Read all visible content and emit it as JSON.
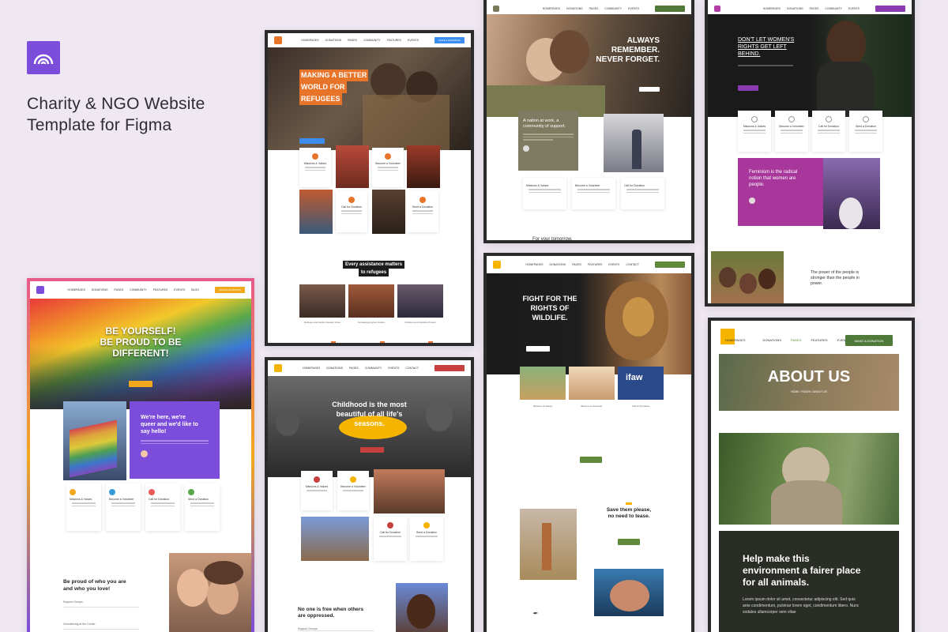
{
  "product": {
    "title_line1": "Charity & NGO Website",
    "title_line2": "Template for Figma",
    "brand_color": "#7c4ddb"
  },
  "nav_common": {
    "links": [
      "HOMEPAGES",
      "DONATIONS",
      "PAGES",
      "COMMUNITY",
      "FEATURES",
      "EVENTS",
      "BLOG",
      "CONTACT"
    ]
  },
  "refugees": {
    "hero_line1": "MAKING A BETTER",
    "hero_line2": "WORLD FOR",
    "hero_line3": "REFUGEES",
    "cta": "MAKE A DONATION",
    "accent": "#e8742a",
    "cards": [
      "Missions & Values",
      "Become a Volunteer",
      "Call for Donation",
      "Send a Donation"
    ],
    "band_line1": "Every assistance matters",
    "band_line2": "to refugees",
    "stories": [
      "Refugee and Asylum Seeker Voice",
      "Increasing Asylum Justice",
      "Children and Families Project"
    ]
  },
  "veterans": {
    "hero_line1": "ALWAYS",
    "hero_line2": "REMEMBER.",
    "hero_line3": "NEVER FORGET.",
    "quote_line1": "A nation at work, a",
    "quote_line2": "community of support.",
    "cards": [
      "Missions & Values",
      "Become a Volunteer",
      "Call for Donation"
    ],
    "footer_text": "For your tomorrow,",
    "accent": "#4f7a3a"
  },
  "women": {
    "hero_line1": "DON'T LET WOMEN'S",
    "hero_line2": "RIGHTS GET LEFT",
    "hero_line3": "BEHIND.",
    "accent": "#8a3bb2",
    "cards": [
      "Missions & Values",
      "Become a Volunteer",
      "Call for Donation",
      "Send a Donation"
    ],
    "quote_line1": "Feminism is the radical",
    "quote_line2": "notion that women are",
    "quote_line3": "people.",
    "power_line1": "The power of the people is",
    "power_line2": "stronger than the people in",
    "power_line3": "power."
  },
  "pride": {
    "hero_line1": "BE YOURSELF!",
    "hero_line2": "BE PROUD TO BE",
    "hero_line3": "DIFFERENT!",
    "cta": "MAKE A DONATION",
    "accent": "#f2a81d",
    "panel_line1": "We're here, we're",
    "panel_line2": "queer and we'd like to",
    "panel_line3": "say hello!",
    "cards": [
      "Missions & Values",
      "Become a Volunteer",
      "Call for Donation",
      "Send a Donation"
    ],
    "proud_line1": "Be proud of who you are",
    "proud_line2": "and who you love!",
    "list": [
      "Support Groups",
      "Volunteering at the Center"
    ]
  },
  "children": {
    "hero_line1": "Childhood is the most",
    "hero_line2": "beautiful of all life's",
    "hero_line3": "seasons.",
    "accent": "#f5b400",
    "cta_color": "#c64040",
    "cards": [
      "Missions & Values",
      "Become a Volunteer",
      "Call for Donation",
      "Send a Donation"
    ],
    "free_line1": "No one is free when others",
    "free_line2": "are oppressed.",
    "list": [
      "Support Groups"
    ]
  },
  "wildlife": {
    "hero_line1": "FIGHT FOR THE",
    "hero_line2": "RIGHTS OF",
    "hero_line3": "WILDLIFE.",
    "accent": "#5f8a3b",
    "cards": [
      "Missions & Values",
      "Become a Volunteer",
      "Call for Donation"
    ],
    "ifaw": "ifaw",
    "tease_line1": "Save them please,",
    "tease_line2": "no need to tease."
  },
  "about": {
    "nav": [
      "HOMEPAGES",
      "DONATIONS",
      "PAGES",
      "FEATURES",
      "EVEN"
    ],
    "cta": "MAKE A DONATION",
    "title": "ABOUT US",
    "breadcrumb": "HOME  /  PAGES  /  ABOUT US",
    "help_line1": "Help make this",
    "help_line2": "environment a fairer place",
    "help_line3": "for all animals.",
    "body1": "Lorem ipsum dolor sit amet, consectetur adipiscing elit. Sed quis",
    "body2": "ante condimentum, pulvinar lorem eget, condimentum libero. Nunc",
    "body3": "sodales ullamcorper sem vitae",
    "accent": "#f5b400",
    "cta_color": "#4f7a3a"
  }
}
